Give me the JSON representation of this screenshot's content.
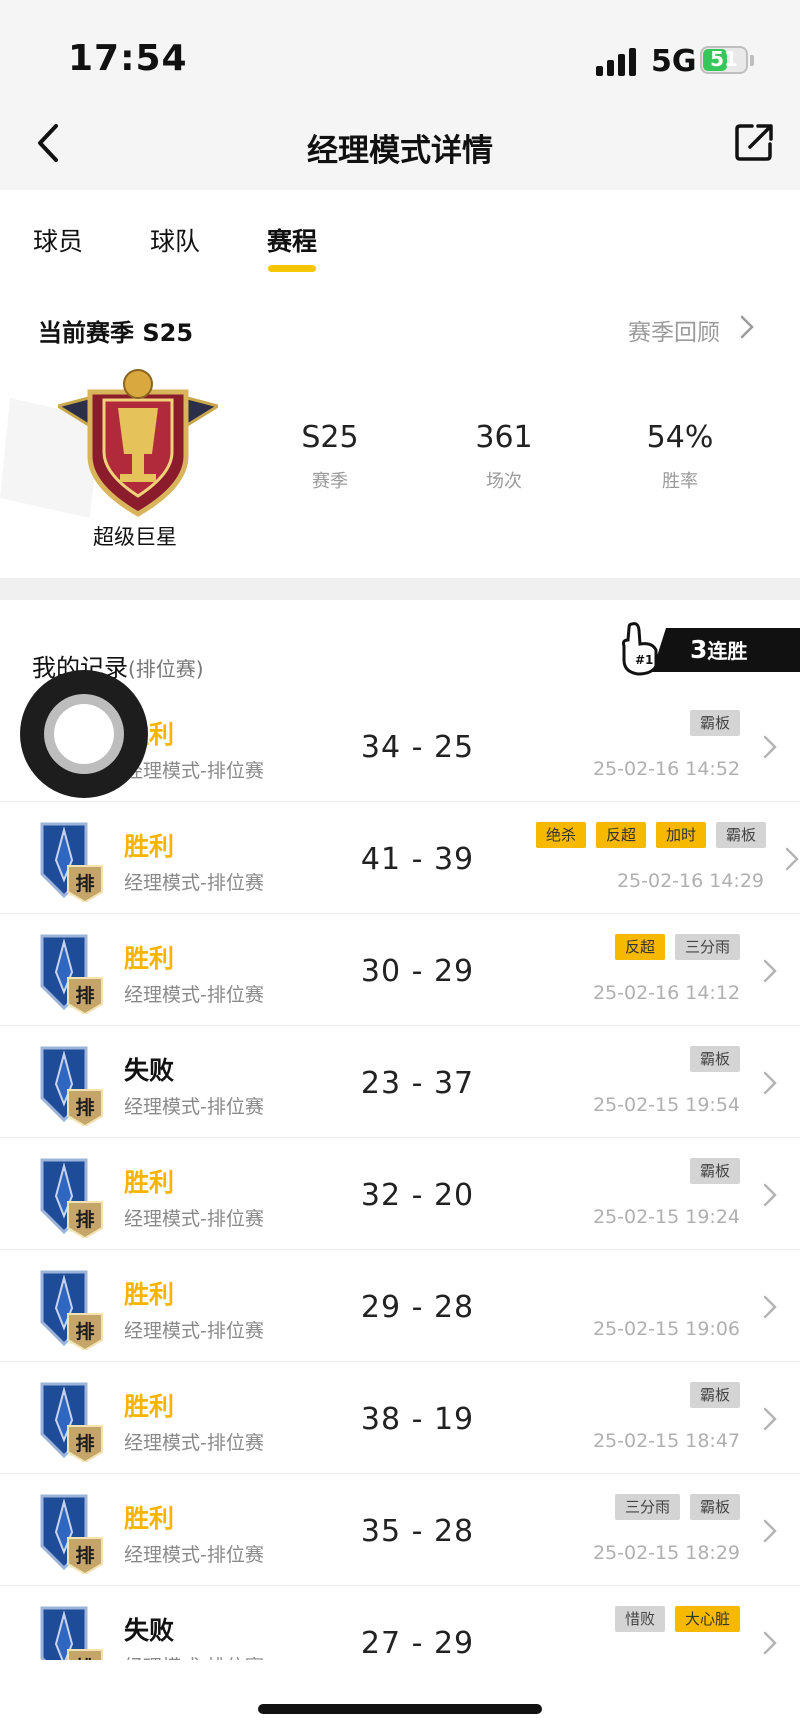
{
  "status_bar": {
    "time": "17:54",
    "network": "5G",
    "battery": "51"
  },
  "header": {
    "title": "经理模式详情"
  },
  "tabs": [
    {
      "label": "球员",
      "active": false
    },
    {
      "label": "球队",
      "active": false
    },
    {
      "label": "赛程",
      "active": true
    }
  ],
  "season": {
    "title": "当前赛季 S25",
    "review_link": "赛季回顾",
    "rank_name": "超级巨星",
    "stats": [
      {
        "value": "S25",
        "label": "赛季"
      },
      {
        "value": "361",
        "label": "场次"
      },
      {
        "value": "54%",
        "label": "胜率"
      }
    ]
  },
  "records": {
    "title": "我的记录",
    "subtitle": "(排位赛)",
    "streak_number": "3",
    "streak_text": "连胜",
    "icon_label": "排",
    "items": [
      {
        "result": "胜利",
        "win": true,
        "mode": "经理模式-排位赛",
        "score": "34 - 25",
        "tags": [
          {
            "text": "霸板",
            "style": "gray"
          }
        ],
        "date": "25-02-16 14:52"
      },
      {
        "result": "胜利",
        "win": true,
        "mode": "经理模式-排位赛",
        "score": "41 - 39",
        "tags": [
          {
            "text": "绝杀",
            "style": "yellow"
          },
          {
            "text": "反超",
            "style": "yellow"
          },
          {
            "text": "加时",
            "style": "yellow"
          },
          {
            "text": "霸板",
            "style": "gray"
          }
        ],
        "date": "25-02-16 14:29"
      },
      {
        "result": "胜利",
        "win": true,
        "mode": "经理模式-排位赛",
        "score": "30 - 29",
        "tags": [
          {
            "text": "反超",
            "style": "yellow"
          },
          {
            "text": "三分雨",
            "style": "gray"
          }
        ],
        "date": "25-02-16 14:12"
      },
      {
        "result": "失败",
        "win": false,
        "mode": "经理模式-排位赛",
        "score": "23 - 37",
        "tags": [
          {
            "text": "霸板",
            "style": "gray"
          }
        ],
        "date": "25-02-15 19:54"
      },
      {
        "result": "胜利",
        "win": true,
        "mode": "经理模式-排位赛",
        "score": "32 - 20",
        "tags": [
          {
            "text": "霸板",
            "style": "gray"
          }
        ],
        "date": "25-02-15 19:24"
      },
      {
        "result": "胜利",
        "win": true,
        "mode": "经理模式-排位赛",
        "score": "29 - 28",
        "tags": [],
        "date": "25-02-15 19:06"
      },
      {
        "result": "胜利",
        "win": true,
        "mode": "经理模式-排位赛",
        "score": "38 - 19",
        "tags": [
          {
            "text": "霸板",
            "style": "gray"
          }
        ],
        "date": "25-02-15 18:47"
      },
      {
        "result": "胜利",
        "win": true,
        "mode": "经理模式-排位赛",
        "score": "35 - 28",
        "tags": [
          {
            "text": "三分雨",
            "style": "gray"
          },
          {
            "text": "霸板",
            "style": "gray"
          }
        ],
        "date": "25-02-15 18:29"
      },
      {
        "result": "失败",
        "win": false,
        "mode": "经理模式-排位赛",
        "score": "27 - 29",
        "tags": [
          {
            "text": "惜败",
            "style": "gray"
          },
          {
            "text": "大心脏",
            "style": "yellow"
          }
        ],
        "date": ""
      }
    ]
  },
  "colors": {
    "accent": "#f6c500",
    "win": "#f7b500",
    "tag_yellow": "#f7b900",
    "tag_gray": "#d4d4d4"
  }
}
